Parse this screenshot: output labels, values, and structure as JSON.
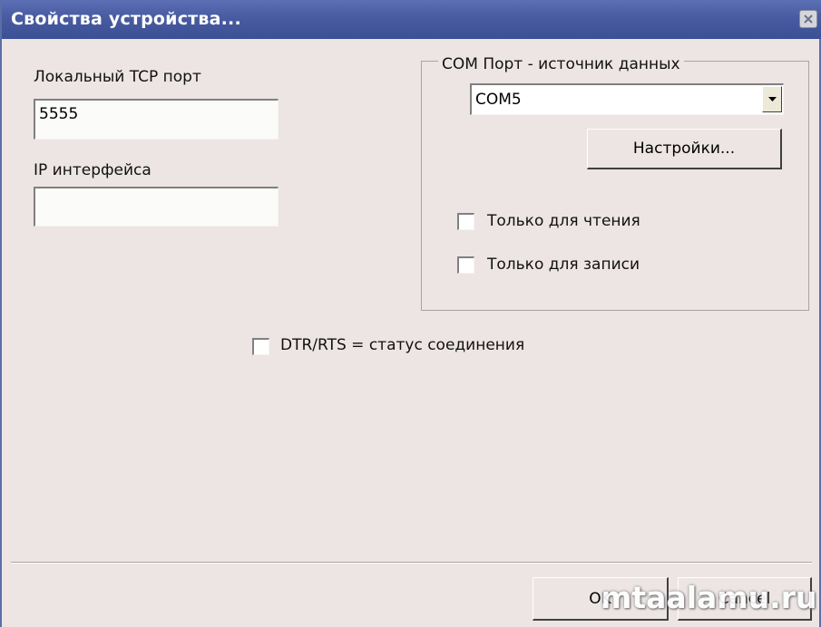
{
  "window": {
    "title": "Свойства устройства...",
    "close_icon": "close-icon"
  },
  "tcp": {
    "local_port_label": "Локальный TCP порт",
    "local_port_value": "5555",
    "ip_label": "IP интерфейса",
    "ip_value": ""
  },
  "com_group": {
    "legend": "COM Порт - источник данных",
    "selected_port": "COM5",
    "settings_button": "Настройки...",
    "read_only_label": "Только для чтения",
    "read_only_checked": false,
    "write_only_label": "Только для записи",
    "write_only_checked": false
  },
  "dtr_rts": {
    "label": "DTR/RTS = статус соединения",
    "checked": false
  },
  "footer": {
    "ok_label": "OK",
    "cancel_label": "Cancel"
  },
  "watermark": "mtaalamu.ru",
  "colors": {
    "title_bar": "#4a5da3",
    "dialog_bg": "#ece5e4"
  }
}
